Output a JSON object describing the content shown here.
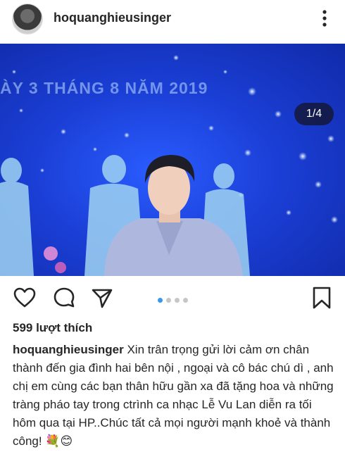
{
  "post": {
    "username": "hoquanghieusinger",
    "image_counter": "1/4",
    "banner_text": "ÀY 3 THÁNG 8 NĂM 2019",
    "likes": "599 lượt thích",
    "caption_user": "hoquanghieusinger",
    "caption_text": "Xin trân trọng gửi lời cảm ơn chân thành đến gia đình hai bên nội , ngoại và cô bác chú dì , anh chị em cùng các bạn thân hữu gần xa đã tặng hoa và những tràng pháo tay trong ctrình ca nhạc Lễ Vu Lan diễn ra tối hôm qua tại HP..Chúc tất cả mọi người mạnh khoẻ và thành công! 💐😊",
    "carousel": {
      "count": 4,
      "active_index": 0
    }
  },
  "icons": [
    "more-vertical-icon",
    "heart-icon",
    "comment-icon",
    "share-icon",
    "bookmark-icon"
  ],
  "colors": {
    "active_dot": "#3897f0",
    "stage_blue": "#1b3fd6",
    "text": "#262626"
  }
}
